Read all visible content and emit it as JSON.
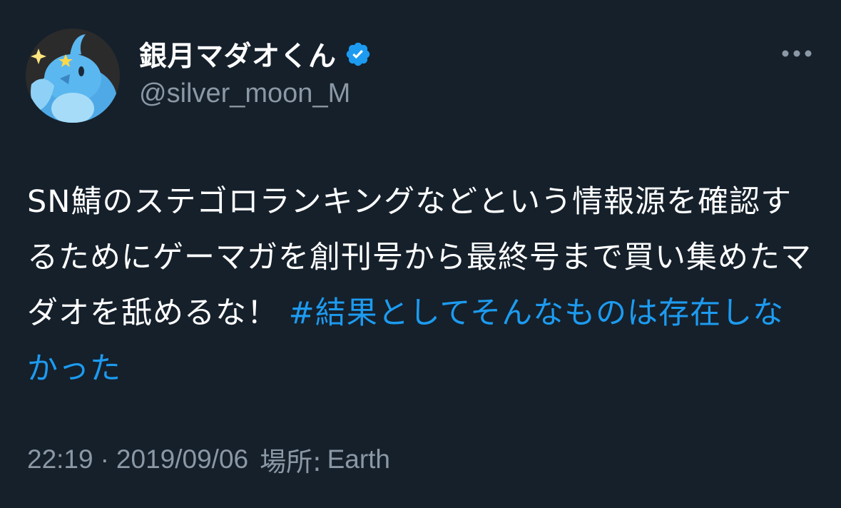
{
  "user": {
    "display_name": "銀月マダオくん",
    "handle": "@silver_moon_M",
    "verified": true,
    "avatar_icon": "blue-bird-avatar-icon"
  },
  "tweet": {
    "text": "SN鯖のステゴロランキングなどという情報源を確認するためにゲーマガを創刊号から最終号まで買い集めたマダオを舐めるな！",
    "hashtag": "#結果としてそんなものは存在しなかった"
  },
  "meta": {
    "time": "22:19",
    "separator": "·",
    "date": "2019/09/06",
    "location_label": "場所:",
    "location_value": "Earth"
  },
  "colors": {
    "background": "#15202b",
    "text": "#ffffff",
    "muted": "#8b98a5",
    "accent": "#1d9bf0"
  },
  "icons": {
    "more": "more-options-icon",
    "verified": "verified-badge-icon"
  }
}
